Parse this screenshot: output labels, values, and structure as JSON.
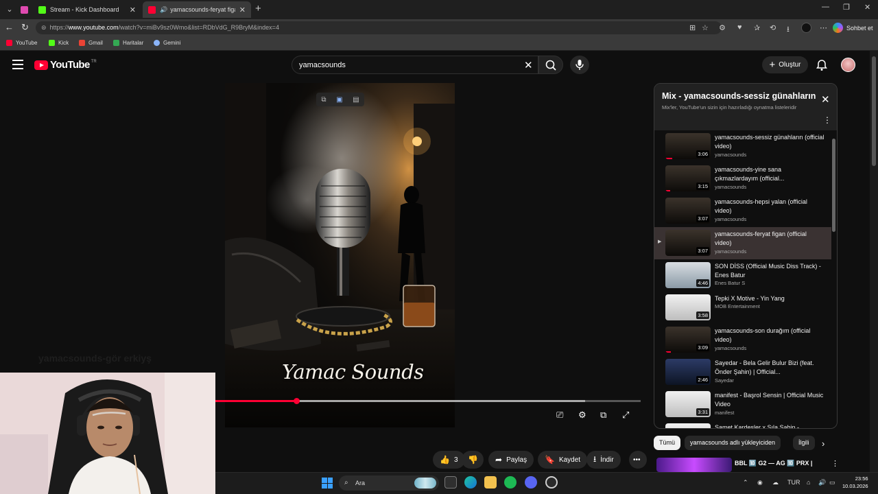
{
  "browser": {
    "tabs": [
      {
        "label": "Stream - Kick Dashboard"
      },
      {
        "label": "yamacsounds-feryat figan (of..."
      }
    ],
    "url_prefix": "https://",
    "url_host": "www.youtube.com",
    "url_path": "/watch?v=miBv9sz0Wmo&list=RDbVdG_R9BryM&index=4",
    "copilot_label": "Sohbet et",
    "bookmarks": [
      {
        "label": "YouTube",
        "color": "#ff0033"
      },
      {
        "label": "Kick",
        "color": "#53fc18"
      },
      {
        "label": "Gmail",
        "color": "#ea4335"
      },
      {
        "label": "Haritalar",
        "color": "#34a853"
      },
      {
        "label": "Gemini",
        "color": "#8ab4f8"
      }
    ]
  },
  "youtube": {
    "logo_text": "YouTube",
    "country_code": "TR",
    "search_value": "yamacsounds",
    "create_label": "Oluştur"
  },
  "video": {
    "brand_text": "Yamac Sounds",
    "progress": 0.19,
    "loaded": 0.87,
    "ghost_title": "yamacsounds-gör erkiyş"
  },
  "actions": {
    "likes": "3",
    "share": "Paylaş",
    "save": "Kaydet",
    "download": "İndir"
  },
  "playlist": {
    "title": "Mix - yamacsounds-sessiz günahların...",
    "subtitle": "Mix'ler, YouTube'un sizin için hazırladığı oynatma listeleridir",
    "items": [
      {
        "title": "yamacsounds-sessiz günahların (official video)",
        "channel": "yamacsounds",
        "duration": "3:06",
        "thumb": "dark",
        "watched": 0.15
      },
      {
        "title": "yamacsounds-yine sana çıkmazlardayım (official...",
        "channel": "yamacsounds",
        "duration": "3:15",
        "thumb": "dark",
        "watched": 0.1
      },
      {
        "title": "yamacsounds-hepsi yalan (official video)",
        "channel": "yamacsounds",
        "duration": "3:07",
        "thumb": "dark",
        "watched": 0
      },
      {
        "title": "yamacsounds-feryat figan (official video)",
        "channel": "yamacsounds",
        "duration": "3:07",
        "thumb": "dark",
        "watched": 0,
        "current": true
      },
      {
        "title": "SON DİSS (Official Music Diss Track) - Enes Batur",
        "channel": "Enes Batur S",
        "duration": "4:46",
        "thumb": "light",
        "watched": 0
      },
      {
        "title": "Tepki X Motive - Yin Yang",
        "channel": "MOB Entertainment",
        "duration": "3:58",
        "thumb": "white",
        "watched": 0
      },
      {
        "title": "yamacsounds-son durağım (official video)",
        "channel": "yamacsounds",
        "duration": "3:09",
        "thumb": "dark",
        "watched": 0.12
      },
      {
        "title": "Sayedar - Bela Gelir Bulur Bizi (feat. Önder Şahin) | Official...",
        "channel": "Sayedar",
        "duration": "2:46",
        "thumb": "blue",
        "watched": 0
      },
      {
        "title": "manifest - Başrol Sensin | Official Music Video",
        "channel": "manifest",
        "duration": "3:31",
        "thumb": "white",
        "watched": 0
      },
      {
        "title": "Samet Kardeşler x Sıla Şahin -",
        "channel": "",
        "duration": "",
        "thumb": "white",
        "watched": 0
      }
    ]
  },
  "chips": [
    "Tümü",
    "yamacsounds adlı yükleyiciden",
    "İlgili"
  ],
  "next_card_text": "BBL 🔟 G2 — AG 🔟 PRX |",
  "taskbar": {
    "search_label": "Ara",
    "lang": "TUR",
    "time": "23:56",
    "date": "10.03.2026"
  }
}
